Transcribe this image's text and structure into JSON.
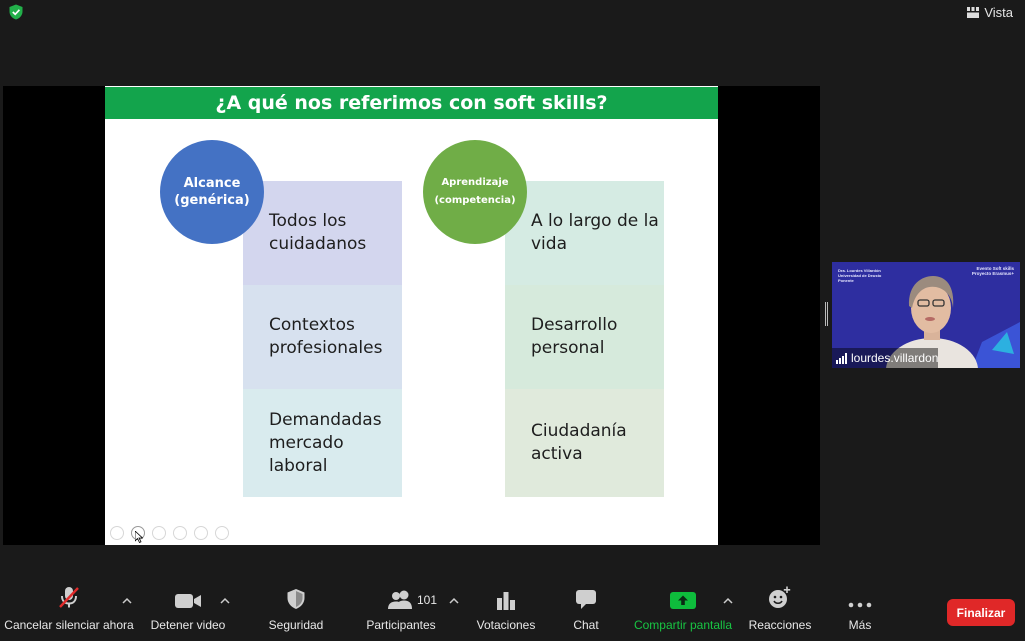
{
  "topbar": {
    "view_label": "Vista"
  },
  "slide": {
    "title": "¿A qué nos referimos con soft skills?",
    "left": {
      "circle_line1": "Alcance",
      "circle_line2": "(genérica)",
      "items": [
        "Todos los cuidadanos",
        "Contextos profesionales",
        "Demandadas mercado laboral"
      ]
    },
    "right": {
      "circle_line1": "Aprendizaje",
      "circle_line2": "(competencia)",
      "items": [
        "A lo largo de la vida",
        "Desarrollo personal",
        "Ciudadanía activa"
      ]
    }
  },
  "video_tile": {
    "participant_name": "lourdes.villardon",
    "left_caption": [
      "Dra. Lourdes Villardón",
      "Universidad de Deusto",
      "Ponente"
    ],
    "right_caption": [
      "Evento Soft skills",
      "Proyecto Erasmus+"
    ]
  },
  "toolbar": {
    "unmute": "Cancelar silenciar ahora",
    "stop_video": "Detener video",
    "security": "Seguridad",
    "participants": "Participantes",
    "participants_count": "101",
    "polls": "Votaciones",
    "chat": "Chat",
    "share": "Compartir pantalla",
    "reactions": "Reacciones",
    "more": "Más",
    "end": "Finalizar"
  },
  "colors": {
    "title_bar": "#13a44c",
    "circle_left": "#4472c4",
    "circle_right": "#70ad47",
    "share_green": "#0ebc3c",
    "end_red": "#e02828"
  }
}
